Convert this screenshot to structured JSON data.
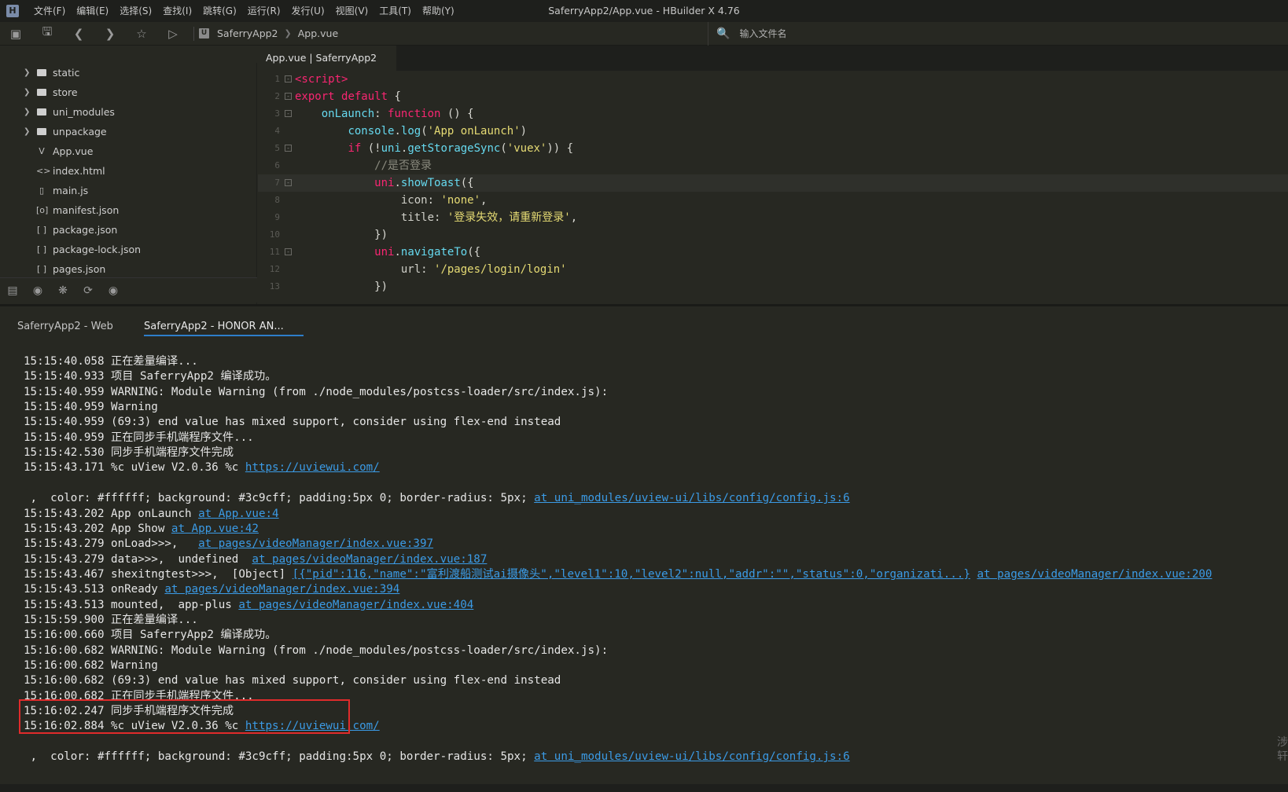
{
  "window": {
    "title": "SaferryApp2/App.vue - HBuilder X 4.76",
    "logo": "H"
  },
  "menu": [
    "文件(F)",
    "编辑(E)",
    "选择(S)",
    "查找(I)",
    "跳转(G)",
    "运行(R)",
    "发行(U)",
    "视图(V)",
    "工具(T)",
    "帮助(Y)"
  ],
  "toolbar": {
    "breadcrumb": [
      "SaferryApp2",
      "App.vue"
    ],
    "file_search_placeholder": "输入文件名"
  },
  "sidebar": {
    "items": [
      {
        "label": "static",
        "type": "folder"
      },
      {
        "label": "store",
        "type": "folder"
      },
      {
        "label": "uni_modules",
        "type": "folder"
      },
      {
        "label": "unpackage",
        "type": "folder"
      },
      {
        "label": "App.vue",
        "type": "vue",
        "icon": "V"
      },
      {
        "label": "index.html",
        "type": "html",
        "icon": "<>"
      },
      {
        "label": "main.js",
        "type": "js",
        "icon": "▯"
      },
      {
        "label": "manifest.json",
        "type": "json",
        "icon": "[o]"
      },
      {
        "label": "package.json",
        "type": "json",
        "icon": "[ ]"
      },
      {
        "label": "package-lock.json",
        "type": "json",
        "icon": "[ ]"
      },
      {
        "label": "pages.json",
        "type": "json",
        "icon": "[ ]"
      }
    ]
  },
  "editor": {
    "tab_label": "App.vue | SaferryApp2",
    "lines": [
      "1",
      "2",
      "3",
      "4",
      "5",
      "6",
      "7",
      "8",
      "9",
      "10",
      "11",
      "12",
      "13"
    ]
  },
  "console": {
    "tabs": [
      "SaferryApp2 - Web",
      "SaferryApp2 - HONOR AN..."
    ],
    "logs": [
      {
        "text": "15:15:40.058 正在差量编译..."
      },
      {
        "text": "15:15:40.933 项目 SaferryApp2 编译成功。"
      },
      {
        "text": "15:15:40.959 WARNING: Module Warning (from ./node_modules/postcss-loader/src/index.js):"
      },
      {
        "text": "15:15:40.959 Warning"
      },
      {
        "text": "15:15:40.959 (69:3) end value has mixed support, consider using flex-end instead"
      },
      {
        "text": "15:15:40.959 正在同步手机端程序文件..."
      },
      {
        "text": "15:15:42.530 同步手机端程序文件完成"
      },
      {
        "text": "15:15:43.171 %c uView V2.0.36 %c ",
        "link": "https://uviewui.com/"
      },
      {
        "text": ""
      },
      {
        "text": " ,  color: #ffffff; background: #3c9cff; padding:5px 0; border-radius: 5px; ",
        "link": "at uni_modules/uview-ui/libs/config/config.js:6"
      },
      {
        "text": "15:15:43.202 App onLaunch ",
        "link": "at App.vue:4"
      },
      {
        "text": "15:15:43.202 App Show ",
        "link": "at App.vue:42"
      },
      {
        "text": "15:15:43.279 onLoad>>>,   ",
        "link": "at pages/videoManager/index.vue:397"
      },
      {
        "text": "15:15:43.279 data>>>,  undefined  ",
        "link": "at pages/videoManager/index.vue:187"
      },
      {
        "text": "15:15:43.467 shexitngtest>>>,  [Object] ",
        "link": "[{\"pid\":116,\"name\":\"富利渡船测试ai摄像头\",\"level1\":10,\"level2\":null,\"addr\":\"\",\"status\":0,\"organizati...}",
        "link2": "at pages/videoManager/index.vue:200"
      },
      {
        "text": "15:15:43.513 onReady ",
        "link": "at pages/videoManager/index.vue:394"
      },
      {
        "text": "15:15:43.513 mounted,  app-plus ",
        "link": "at pages/videoManager/index.vue:404"
      },
      {
        "text": "15:15:59.900 正在差量编译..."
      },
      {
        "text": "15:16:00.660 项目 SaferryApp2 编译成功。"
      },
      {
        "text": "15:16:00.682 WARNING: Module Warning (from ./node_modules/postcss-loader/src/index.js):"
      },
      {
        "text": "15:16:00.682 Warning"
      },
      {
        "text": "15:16:00.682 (69:3) end value has mixed support, consider using flex-end instead"
      },
      {
        "text": "15:16:00.682 正在同步手机端程序文件..."
      },
      {
        "text": "15:16:02.247 同步手机端程序文件完成"
      },
      {
        "text": "15:16:02.884 %c uView V2.0.36 %c ",
        "link": "https://uviewui.com/"
      },
      {
        "text": ""
      },
      {
        "text": " ,  color: #ffffff; background: #3c9cff; padding:5px 0; border-radius: 5px; ",
        "link": "at uni_modules/uview-ui/libs/config/config.js:6"
      }
    ],
    "right_edge_glyphs": "涉\n轩"
  },
  "colors": {
    "background": "#272822",
    "link": "#3b9be6",
    "highlight": "#e02b2b",
    "active_tab_underline": "#2d7ec9"
  }
}
